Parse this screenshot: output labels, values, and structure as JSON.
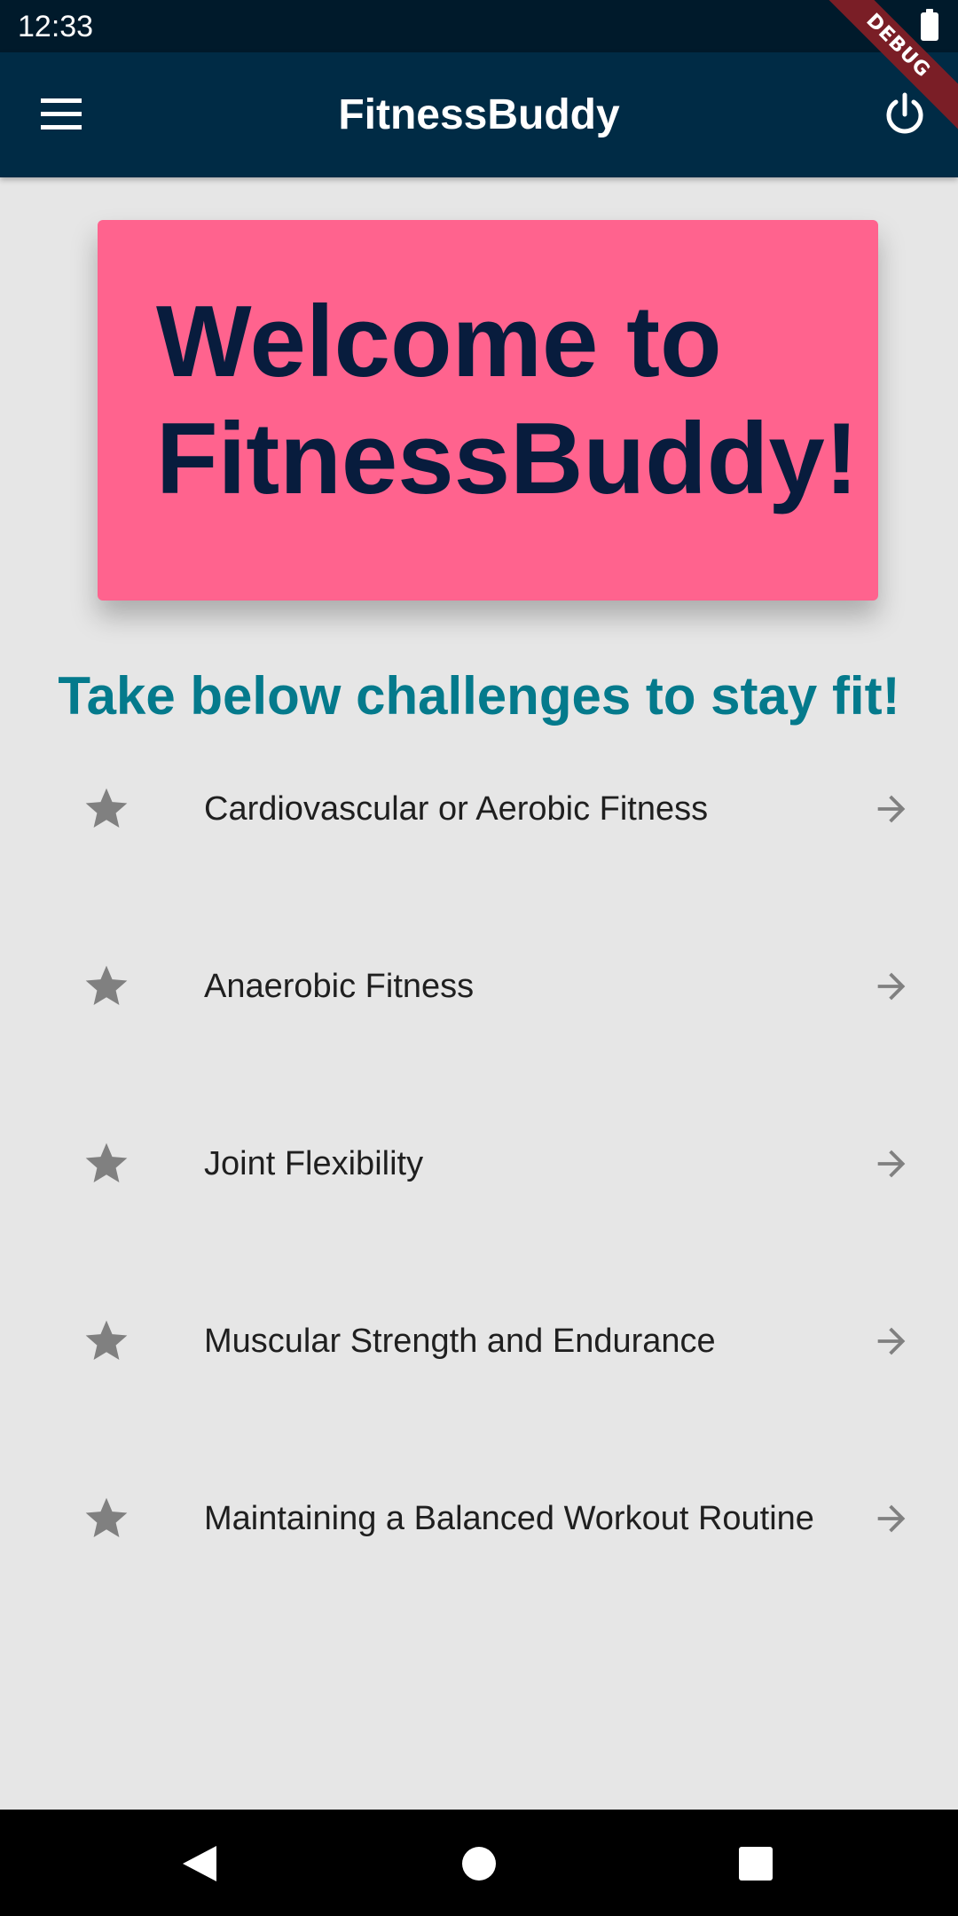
{
  "status_bar": {
    "time": "12:33"
  },
  "debug_banner": "DEBUG",
  "app_bar": {
    "title": "FitnessBuddy",
    "menu_icon": "menu-icon",
    "power_icon": "power-icon"
  },
  "welcome_card": {
    "text": "Welcome to\nFitnessBuddy!"
  },
  "subtitle": "Take below challenges to stay fit!",
  "challenges": [
    {
      "label": "Cardiovascular or Aerobic Fitness",
      "icon": "star-icon",
      "trailing_icon": "arrow-right-icon"
    },
    {
      "label": "Anaerobic Fitness",
      "icon": "star-icon",
      "trailing_icon": "arrow-right-icon"
    },
    {
      "label": "Joint Flexibility",
      "icon": "star-icon",
      "trailing_icon": "arrow-right-icon"
    },
    {
      "label": "Muscular Strength and Endurance",
      "icon": "star-icon",
      "trailing_icon": "arrow-right-icon"
    },
    {
      "label": "Maintaining a Balanced Workout Routine",
      "icon": "star-icon",
      "trailing_icon": "arrow-right-icon"
    }
  ],
  "colors": {
    "status_bar": "#001a2b",
    "app_bar": "#002b45",
    "card": "#ff638e",
    "card_text": "#081c3d",
    "subtitle": "#047a8c",
    "background": "#e6e6e6",
    "icon_gray": "#808080"
  }
}
